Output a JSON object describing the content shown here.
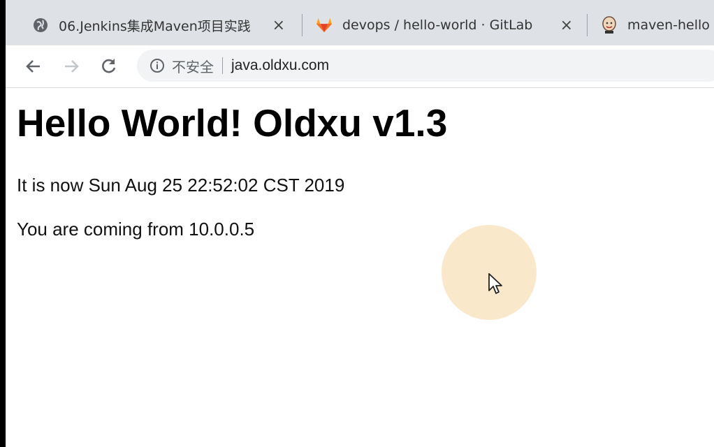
{
  "tabs": [
    {
      "title": "06.Jenkins集成Maven项目实践",
      "favicon": "globe-icon",
      "close": "×"
    },
    {
      "title": "devops / hello-world · GitLab",
      "favicon": "gitlab-fox-icon",
      "close": "×"
    },
    {
      "title": "maven-hello",
      "favicon": "jenkins-butler-icon"
    }
  ],
  "toolbar": {
    "back": "back-arrow-icon",
    "forward": "forward-arrow-icon",
    "reload": "reload-icon"
  },
  "address_bar": {
    "security_label": "不安全",
    "url": "java.oldxu.com"
  },
  "page": {
    "heading": "Hello World! Oldxu v1.3",
    "time_line": "It is now Sun Aug 25 22:52:02 CST 2019",
    "origin_line": "You are coming from 10.0.0.5"
  },
  "colors": {
    "tabstrip": "#dee1e6",
    "omnibox": "#f1f3f4",
    "gitlab_orange": "#e24329",
    "click_highlight": "#f6d6a0"
  }
}
